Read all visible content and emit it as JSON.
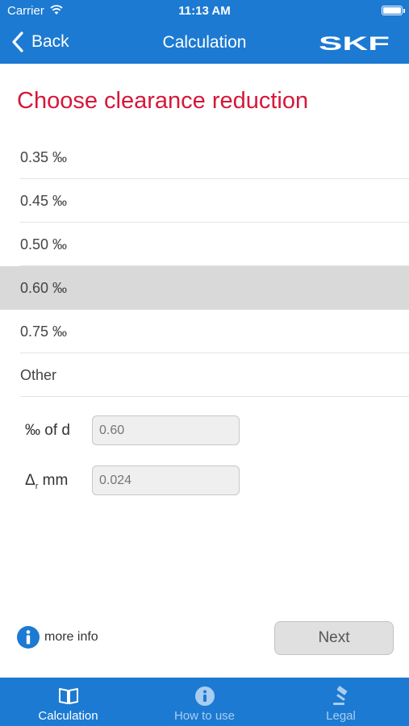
{
  "status_bar": {
    "carrier": "Carrier",
    "time": "11:13 AM"
  },
  "nav": {
    "back_label": "Back",
    "title": "Calculation",
    "brand": "SKF"
  },
  "heading": "Choose clearance reduction",
  "options": [
    {
      "label": "0.35 ‰",
      "selected": false
    },
    {
      "label": "0.45 ‰",
      "selected": false
    },
    {
      "label": "0.50 ‰",
      "selected": false
    },
    {
      "label": "0.60 ‰",
      "selected": true
    },
    {
      "label": "0.75 ‰",
      "selected": false
    },
    {
      "label": "Other",
      "selected": false
    }
  ],
  "fields": {
    "percent_of_d": {
      "label": "‰ of d",
      "placeholder": "0.60"
    },
    "delta_r": {
      "label_main": "Δ",
      "label_sub": "r",
      "label_unit": "mm",
      "placeholder": "0.024"
    }
  },
  "more_info_label": "more info",
  "next_label": "Next",
  "tabs": [
    {
      "label": "Calculation",
      "icon": "book-icon",
      "active": true
    },
    {
      "label": "How to use",
      "icon": "info-icon",
      "active": false
    },
    {
      "label": "Legal",
      "icon": "gavel-icon",
      "active": false
    }
  ],
  "colors": {
    "primary": "#1c7ad2",
    "heading": "#d6173a",
    "selected_row": "#d9d9d9"
  }
}
